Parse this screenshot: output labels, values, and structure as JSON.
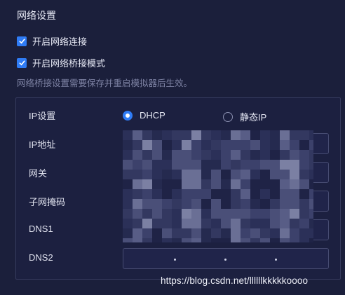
{
  "section": {
    "title": "网络设置"
  },
  "options": {
    "network_connect": {
      "label": "开启网络连接",
      "checked": true
    },
    "bridge_mode": {
      "label": "开启网络桥接模式",
      "checked": true
    }
  },
  "hint": "网络桥接设置需要保存并重启模拟器后生效。",
  "ip_settings": {
    "label": "IP设置",
    "mode_options": [
      "DHCP",
      "静态IP"
    ],
    "selected": "DHCP"
  },
  "fields": {
    "ip_address": {
      "label": "IP地址",
      "value": ""
    },
    "gateway": {
      "label": "网关",
      "value": ""
    },
    "subnet_mask": {
      "label": "子网掩码",
      "value": ""
    },
    "dns1": {
      "label": "DNS1",
      "value": ""
    },
    "dns2": {
      "label": "DNS2",
      "value": ". . ."
    }
  },
  "watermark": "https://blog.csdn.net/llllllkkkkkoooo",
  "colors": {
    "accent": "#2f7cf6",
    "background": "#1b1f3b",
    "panel_border": "#363b5e"
  },
  "icons": {
    "checkbox": "check-icon",
    "radio": "radio-icon"
  }
}
